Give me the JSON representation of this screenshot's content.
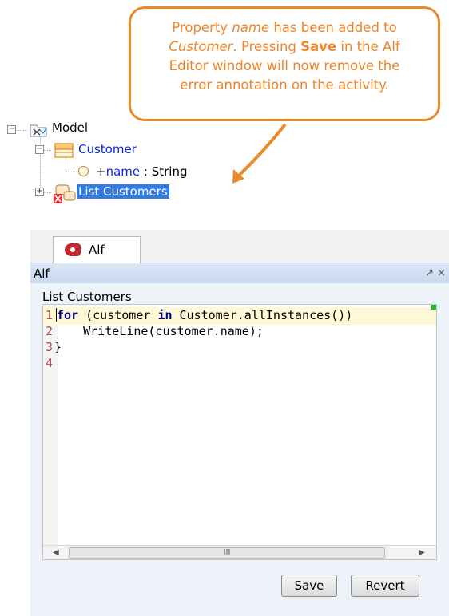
{
  "callout": {
    "line1_a": "Property ",
    "line1_i": "name",
    "line1_b": " has been added to",
    "line2_i": "Customer",
    "line2_a": ". Pressing ",
    "line2_b": "Save",
    "line2_c": " in the Alf",
    "line3": "Editor window will now remove the",
    "line4": "error annotation on the activity."
  },
  "tree": {
    "root": "Model",
    "customer": "Customer",
    "property_vis": "+",
    "property_name": "name",
    "property_type": " : String",
    "activity": "List Customers"
  },
  "panel": {
    "tab_label": "Alf",
    "title": "Alf",
    "title_icons": "↗ ×",
    "activity_label": "List Customers",
    "code": [
      {
        "num": "1",
        "pre": "",
        "kw1": "for",
        "mid": " (customer ",
        "kw2": "in",
        "post": " Customer.allInstances())"
      },
      {
        "num": "2",
        "text": "    WriteLine(customer.name);"
      },
      {
        "num": "3",
        "text": "}"
      },
      {
        "num": "4",
        "text": ""
      }
    ],
    "scroll_left": "◀",
    "scroll_right": "▶",
    "scroll_grip": "III",
    "save_label": "Save",
    "revert_label": "Revert"
  },
  "colors": {
    "callout": "#ee8528",
    "link_blue": "#0b24e0",
    "selection": "#2f7be3",
    "keyword": "#00008b",
    "line_number": "#b34747"
  }
}
